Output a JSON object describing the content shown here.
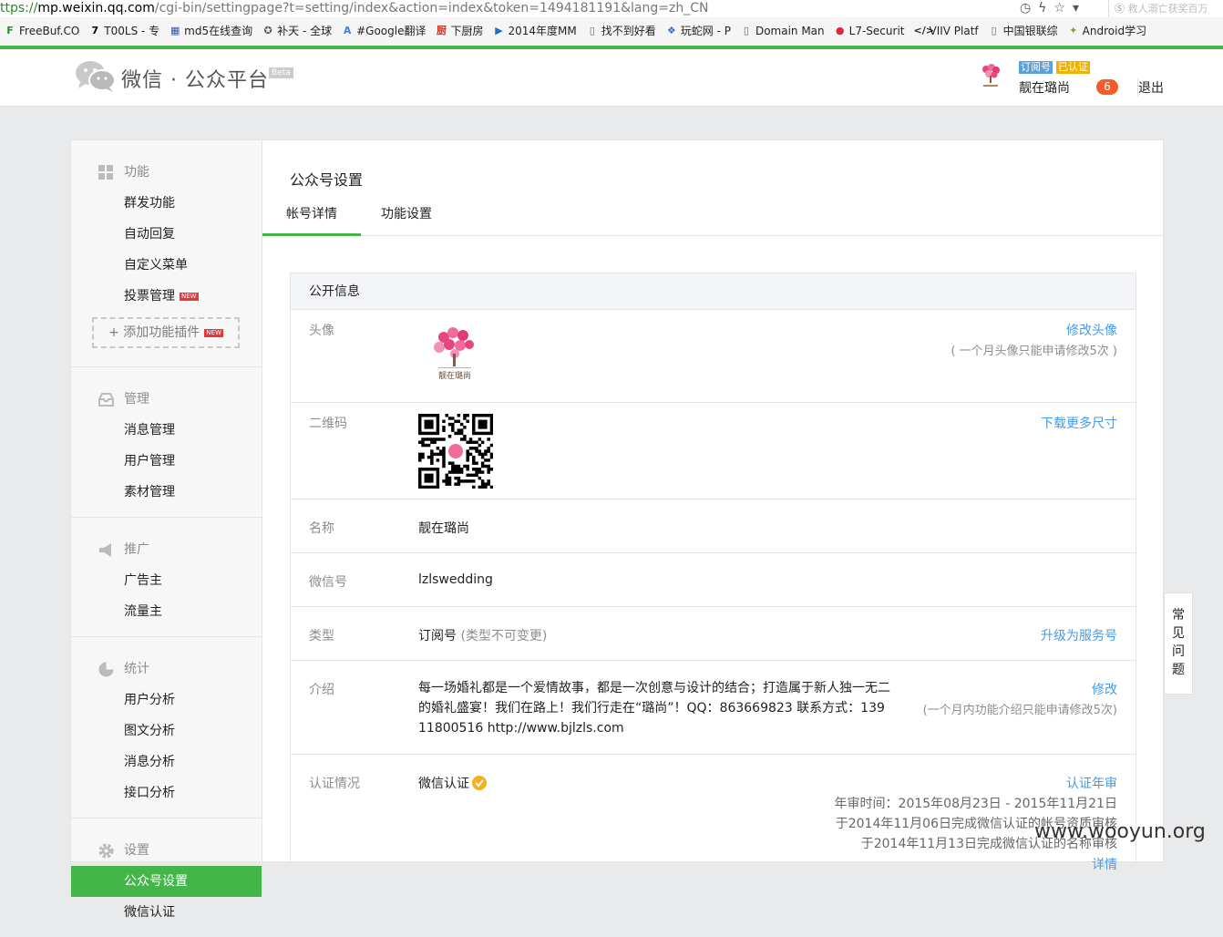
{
  "browser": {
    "url_scheme": "ttps://",
    "url_host": "mp.weixin.qq.com",
    "url_path": "/cgi-bin/settingpage?t=setting/index&action=index&token=1494181191&lang=zh_CN",
    "search_placeholder": "救人溺亡获奖百万",
    "bookmarks": [
      {
        "label": "FreeBuf.CO",
        "icon": "F",
        "color": "#2d8a2d"
      },
      {
        "label": "T00LS - 专",
        "icon": "7",
        "color": "#000"
      },
      {
        "label": "md5在线查询",
        "icon": "▦",
        "color": "#3355aa"
      },
      {
        "label": "补天 - 全球",
        "icon": "✪",
        "color": "#555"
      },
      {
        "label": "#Google翻译",
        "icon": "A",
        "color": "#4a7fd8"
      },
      {
        "label": "下厨房",
        "icon": "厨",
        "color": "#c23a2b"
      },
      {
        "label": "2014年度MM",
        "icon": "▶",
        "color": "#1a70c8"
      },
      {
        "label": "找不到好看",
        "icon": "▯",
        "color": "#666"
      },
      {
        "label": "玩蛇网 - P",
        "icon": "❖",
        "color": "#3a6fb0"
      },
      {
        "label": "Domain Man",
        "icon": "▯",
        "color": "#666"
      },
      {
        "label": "L7-Securit",
        "icon": "●",
        "color": "#e0283c"
      },
      {
        "label": "VIIV Platf",
        "icon": "</>",
        "color": "#222"
      },
      {
        "label": "中国银联综",
        "icon": "▯",
        "color": "#666"
      },
      {
        "label": "Android学习",
        "icon": "✦",
        "color": "#7aa43a"
      }
    ]
  },
  "header": {
    "logo_text": "微信 · 公众平台",
    "beta": "Beta",
    "badge_subscription": "订阅号",
    "badge_verified": "已认证",
    "account_name": "靓在璐尚",
    "notifications": "6",
    "logout": "退出"
  },
  "sidebar": {
    "groups": [
      {
        "title": "功能",
        "items": [
          "群发功能",
          "自动回复",
          "自定义菜单",
          "投票管理"
        ],
        "new_tag": "NEW",
        "add_plugin": "添加功能插件"
      },
      {
        "title": "管理",
        "items": [
          "消息管理",
          "用户管理",
          "素材管理"
        ]
      },
      {
        "title": "推广",
        "items": [
          "广告主",
          "流量主"
        ]
      },
      {
        "title": "统计",
        "items": [
          "用户分析",
          "图文分析",
          "消息分析",
          "接口分析"
        ]
      },
      {
        "title": "设置",
        "items": [
          "公众号设置",
          "微信认证"
        ]
      }
    ]
  },
  "main": {
    "title": "公众号设置",
    "tabs": [
      "帐号详情",
      "功能设置"
    ],
    "section_title": "公开信息",
    "rows": {
      "avatar": {
        "label": "头像",
        "action": "修改头像",
        "note": "( 一个月头像只能申请修改5次 )",
        "logo_text": "靓在璐尚"
      },
      "qrcode": {
        "label": "二维码",
        "action": "下载更多尺寸"
      },
      "name": {
        "label": "名称",
        "value": "靓在璐尚"
      },
      "wechat_id": {
        "label": "微信号",
        "value": "lzlswedding"
      },
      "type": {
        "label": "类型",
        "value": "订阅号",
        "hint": "(类型不可变更)",
        "action": "升级为服务号"
      },
      "intro": {
        "label": "介绍",
        "line1": "每一场婚礼都是一个爱情故事，都是一次创意与设计的结合；打造属于新人独一无二",
        "line2": "的婚礼盛宴！我们在路上！我们行走在“璐尚”！QQ：863669823 联系方式：139",
        "line3": "11800516  http://www.bjlzls.com",
        "action": "修改",
        "note": "(一个月内功能介绍只能申请修改5次)"
      },
      "verify": {
        "label": "认证情况",
        "value": "微信认证",
        "action": "认证年审",
        "note1": "年审时间：2015年08月23日 - 2015年11月21日",
        "note2": "于2014年11月06日完成微信认证的帐号资质审核",
        "note3": "于2014年11月13日完成微信认证的名称审核",
        "more": "详情"
      }
    }
  },
  "faq": "常见问题",
  "watermark": "www.wooyun.org",
  "colors": {
    "brand_green": "#44b549",
    "link_blue": "#459ae9",
    "notif_orange": "#f45c2a"
  }
}
